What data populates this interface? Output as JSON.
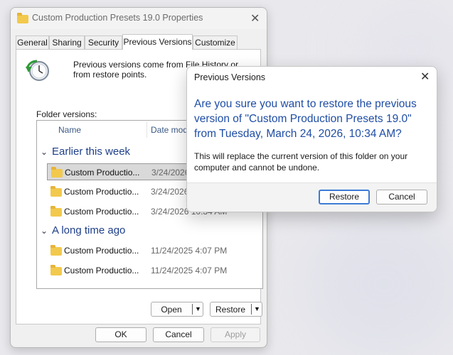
{
  "properties": {
    "title": "Custom Production Presets 19.0 Properties",
    "tabs": [
      "General",
      "Sharing",
      "Security",
      "Previous Versions",
      "Customize"
    ],
    "active_tab": "Previous Versions",
    "info_text": "Previous versions come from File History or from restore points.",
    "folder_versions_label": "Folder versions:",
    "columns": {
      "name": "Name",
      "date": "Date modifie"
    },
    "groups": [
      {
        "label": "Earlier this week",
        "rows": [
          {
            "name": "Custom Productio...",
            "date": "3/24/2026 10:34 AM",
            "selected": true
          },
          {
            "name": "Custom Productio...",
            "date": "3/24/2026 10:34 AM",
            "selected": false
          },
          {
            "name": "Custom Productio...",
            "date": "3/24/2026 10:34 AM",
            "selected": false
          }
        ]
      },
      {
        "label": "A long time ago",
        "rows": [
          {
            "name": "Custom Productio...",
            "date": "11/24/2025 4:07 PM",
            "selected": false
          },
          {
            "name": "Custom Productio...",
            "date": "11/24/2025 4:07 PM",
            "selected": false
          }
        ]
      }
    ],
    "open_label": "Open",
    "restore_label": "Restore",
    "ok_label": "OK",
    "cancel_label": "Cancel",
    "apply_label": "Apply"
  },
  "dialog": {
    "title": "Previous Versions",
    "question": "Are you sure you want to restore the previous version of \"Custom Production Presets 19.0\" from Tuesday, March 24, 2026, 10:34 AM?",
    "detail": "This will replace the current version of this folder on your computer and cannot be undone.",
    "restore_label": "Restore",
    "cancel_label": "Cancel"
  },
  "colors": {
    "accent": "#3d7bd6",
    "question_text": "#1f4da5",
    "group_header": "#1e3f8a",
    "folder": "#f2c94c"
  },
  "icons": {
    "window": "folder-icon",
    "restore": "clock-restore-icon",
    "close": "close-icon"
  }
}
